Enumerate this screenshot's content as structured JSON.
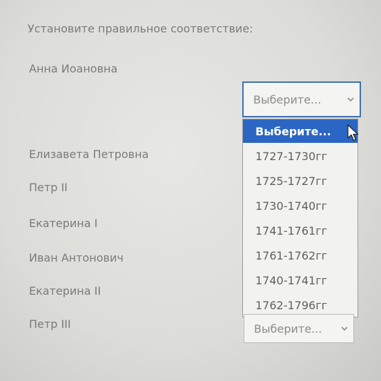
{
  "question": {
    "instruction": "Установите правильное соответствие:"
  },
  "rows": [
    {
      "name": "Анна Иоановна"
    },
    {
      "name": "Елизавета Петровна"
    },
    {
      "name": "Петр II"
    },
    {
      "name": "Екатерина I"
    },
    {
      "name": "Иван Антонович"
    },
    {
      "name": "Екатерина II"
    },
    {
      "name": "Петр III"
    }
  ],
  "select_open": {
    "value": "Выберите...",
    "chevron_icon": "chevron-down-icon"
  },
  "dropdown": {
    "options": [
      {
        "label": "Выберите...",
        "selected": true
      },
      {
        "label": "1727-1730гг"
      },
      {
        "label": "1725-1727гг"
      },
      {
        "label": "1730-1740гг"
      },
      {
        "label": "1741-1761гг"
      },
      {
        "label": "1761-1762гг"
      },
      {
        "label": "1740-1741гг"
      },
      {
        "label": "1762-1796гг"
      }
    ]
  },
  "select_bottom": {
    "value": "Выберите...",
    "chevron_icon": "chevron-down-icon"
  },
  "colors": {
    "selected_bg": "#2b66c4",
    "focus_border": "#3d6fb0",
    "text_gray": "#7a7a7a"
  },
  "cursor_icon": "mouse-pointer-icon"
}
